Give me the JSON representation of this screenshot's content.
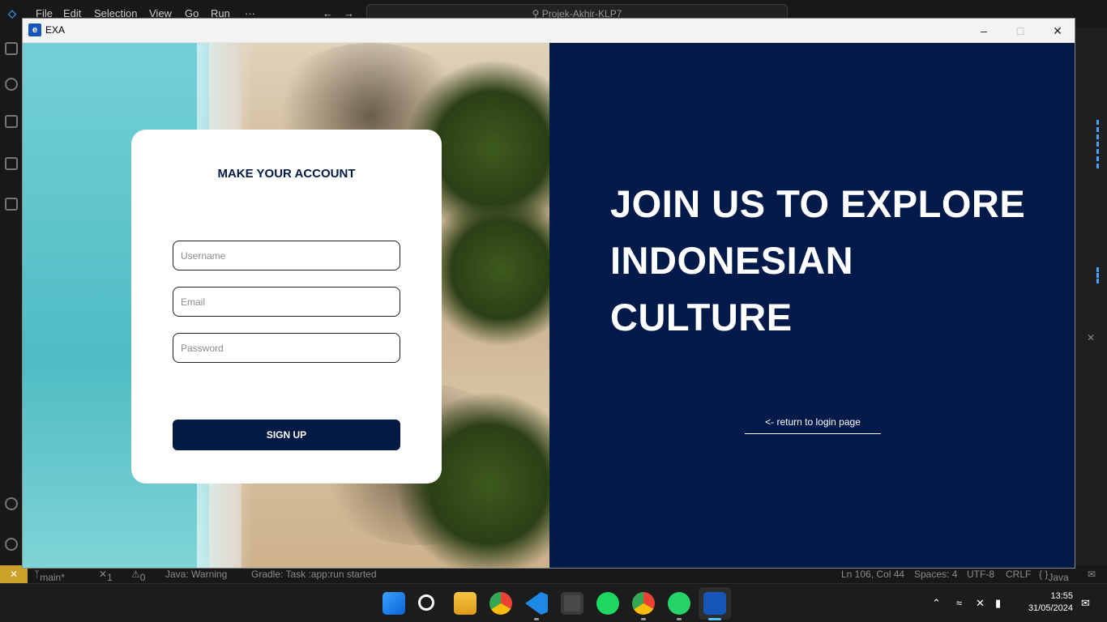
{
  "vscode": {
    "menu": [
      "File",
      "Edit",
      "Selection",
      "View",
      "Go",
      "Run",
      "···"
    ],
    "search_text": "Projek-Akhir-KLP7",
    "status": {
      "branch": "main*",
      "errors": "1",
      "warnings": "0",
      "java_status": "Java: Warning",
      "gradle": "Gradle: Task :app:run started",
      "position": "Ln 106, Col 44",
      "spaces": "Spaces: 4",
      "encoding": "UTF-8",
      "eol": "CRLF",
      "language": "Java"
    }
  },
  "app": {
    "title": "EXA",
    "logo_text": "e",
    "minimize": "–",
    "maximize": "□",
    "close": "✕"
  },
  "form": {
    "title": "MAKE YOUR ACCOUNT",
    "username_placeholder": "Username",
    "email_placeholder": "Email",
    "password_placeholder": "Password",
    "signup_label": "SIGN UP"
  },
  "right": {
    "headline_line1": "JOIN US TO EXPLORE",
    "headline_line2": "INDONESIAN",
    "headline_line3": "CULTURE",
    "back_link": "<- return to login page"
  },
  "taskbar": {
    "time": "13:55",
    "date": "31/05/2024",
    "icons": [
      "start-icon",
      "search-icon",
      "file-explorer-icon",
      "chrome-icon",
      "vscode-icon",
      "sublime-icon",
      "spotify-icon",
      "chrome-profile-icon",
      "whatsapp-icon",
      "exa-app-icon"
    ]
  },
  "colors": {
    "accent": "#031a44",
    "panel": "#021a4a"
  }
}
